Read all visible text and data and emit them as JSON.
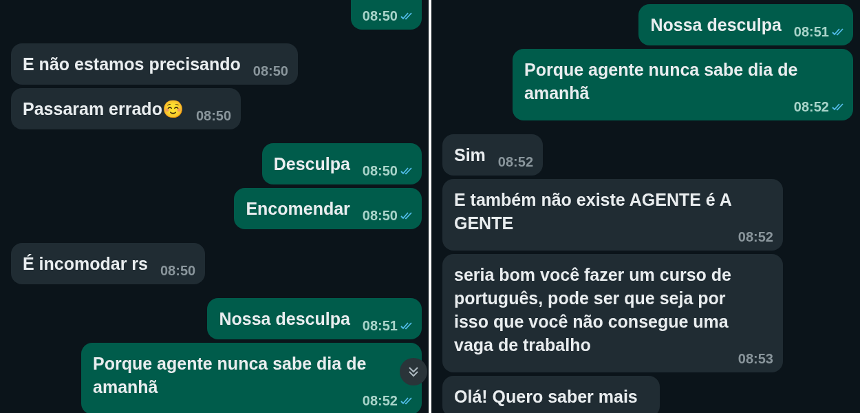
{
  "panels": [
    {
      "messages": [
        {
          "kind": "outgoing",
          "time": "08:50",
          "read": true
        },
        {
          "kind": "incoming",
          "text": "E não estamos precisando",
          "time": "08:50"
        },
        {
          "kind": "incoming",
          "text": "Passaram errado☺️",
          "time": "08:50"
        },
        {
          "kind": "outgoing",
          "text": "Desculpa",
          "time": "08:50",
          "read": true
        },
        {
          "kind": "outgoing",
          "text": "Encomendar",
          "time": "08:50",
          "read": true
        },
        {
          "kind": "incoming",
          "text": "É incomodar rs",
          "time": "08:50"
        },
        {
          "kind": "outgoing",
          "text": "Nossa desculpa",
          "time": "08:51",
          "read": true
        },
        {
          "kind": "outgoing",
          "text": "Porque agente nunca sabe dia de amanhã",
          "time": "08:52",
          "read": true
        }
      ],
      "scroll_button": true
    },
    {
      "messages": [
        {
          "kind": "outgoing",
          "text": "Nossa desculpa",
          "time": "08:51",
          "read": true
        },
        {
          "kind": "outgoing",
          "text": "Porque agente nunca sabe dia de amanhã",
          "time": "08:52",
          "read": true
        },
        {
          "kind": "incoming",
          "text": "Sim",
          "time": "08:52"
        },
        {
          "kind": "incoming",
          "text": "E também não existe AGENTE é A GENTE",
          "time": "08:52"
        },
        {
          "kind": "incoming",
          "text": "seria bom você fazer um curso de português, pode ser que seja por isso que você não consegue uma vaga de trabalho",
          "time": "08:53"
        },
        {
          "kind": "incoming",
          "text": "Olá! Quero saber mais"
        }
      ],
      "scroll_button": false
    }
  ]
}
